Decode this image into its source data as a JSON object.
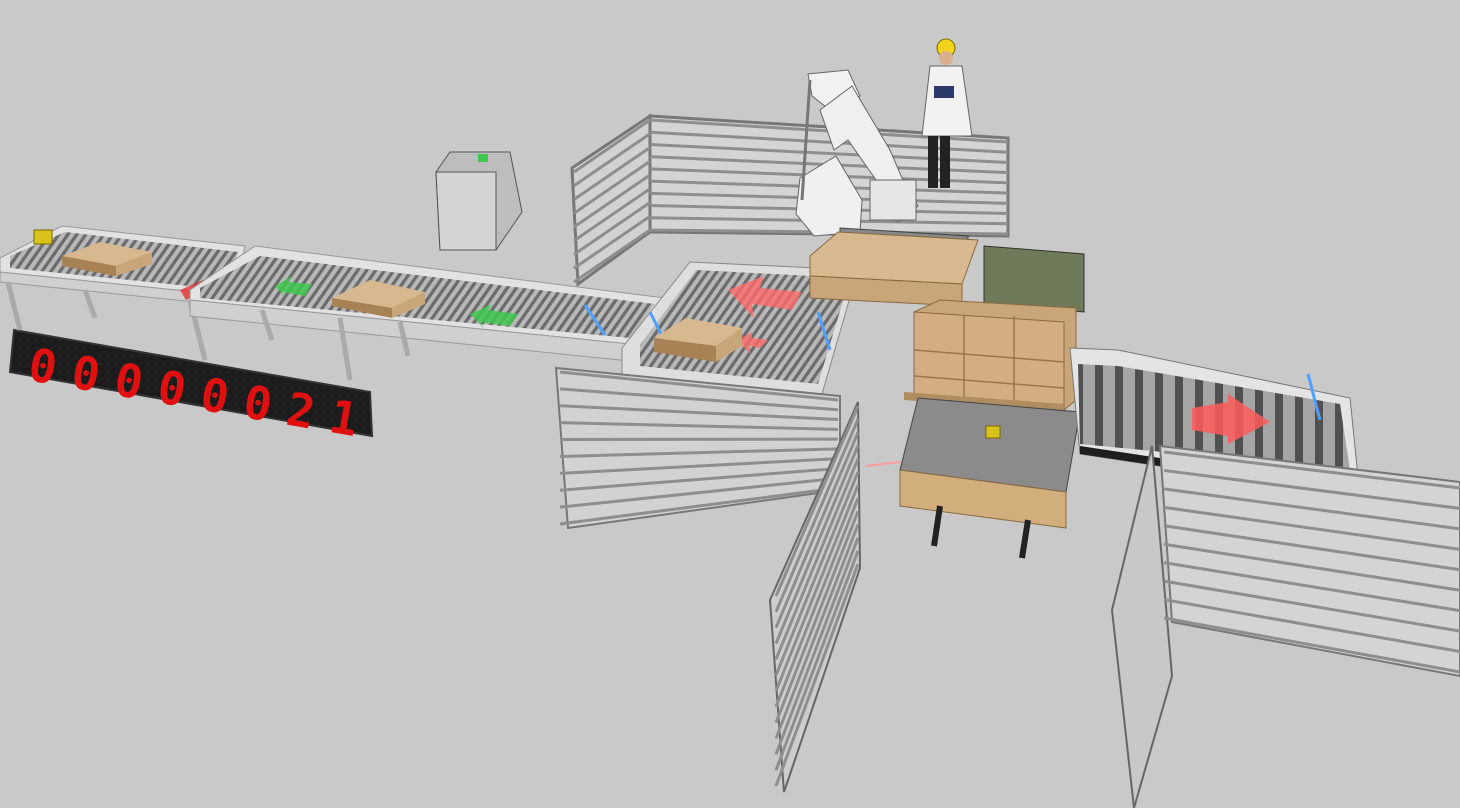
{
  "scene": {
    "background": "#c9c9c9",
    "counter": {
      "digits": [
        "0",
        "0",
        "0",
        "0",
        "0",
        "0",
        "2",
        "1"
      ],
      "color": "#e01010",
      "background": "#1c1c1c"
    },
    "colors": {
      "box": "#c9a57a",
      "box_top": "#d8b88e",
      "box_side": "#a88155",
      "conveyor_frame": "#e4e4e4",
      "roller": "#8a8a8a",
      "fence": "#9a9a9a",
      "green_arrow": "#3fc84e",
      "red_arrow": "#ff5a5a",
      "robot": "#f2f2f2",
      "sensor": "#d9c21a",
      "helmet": "#f2d21a"
    },
    "icons": [
      "right-arrow-icon"
    ]
  }
}
